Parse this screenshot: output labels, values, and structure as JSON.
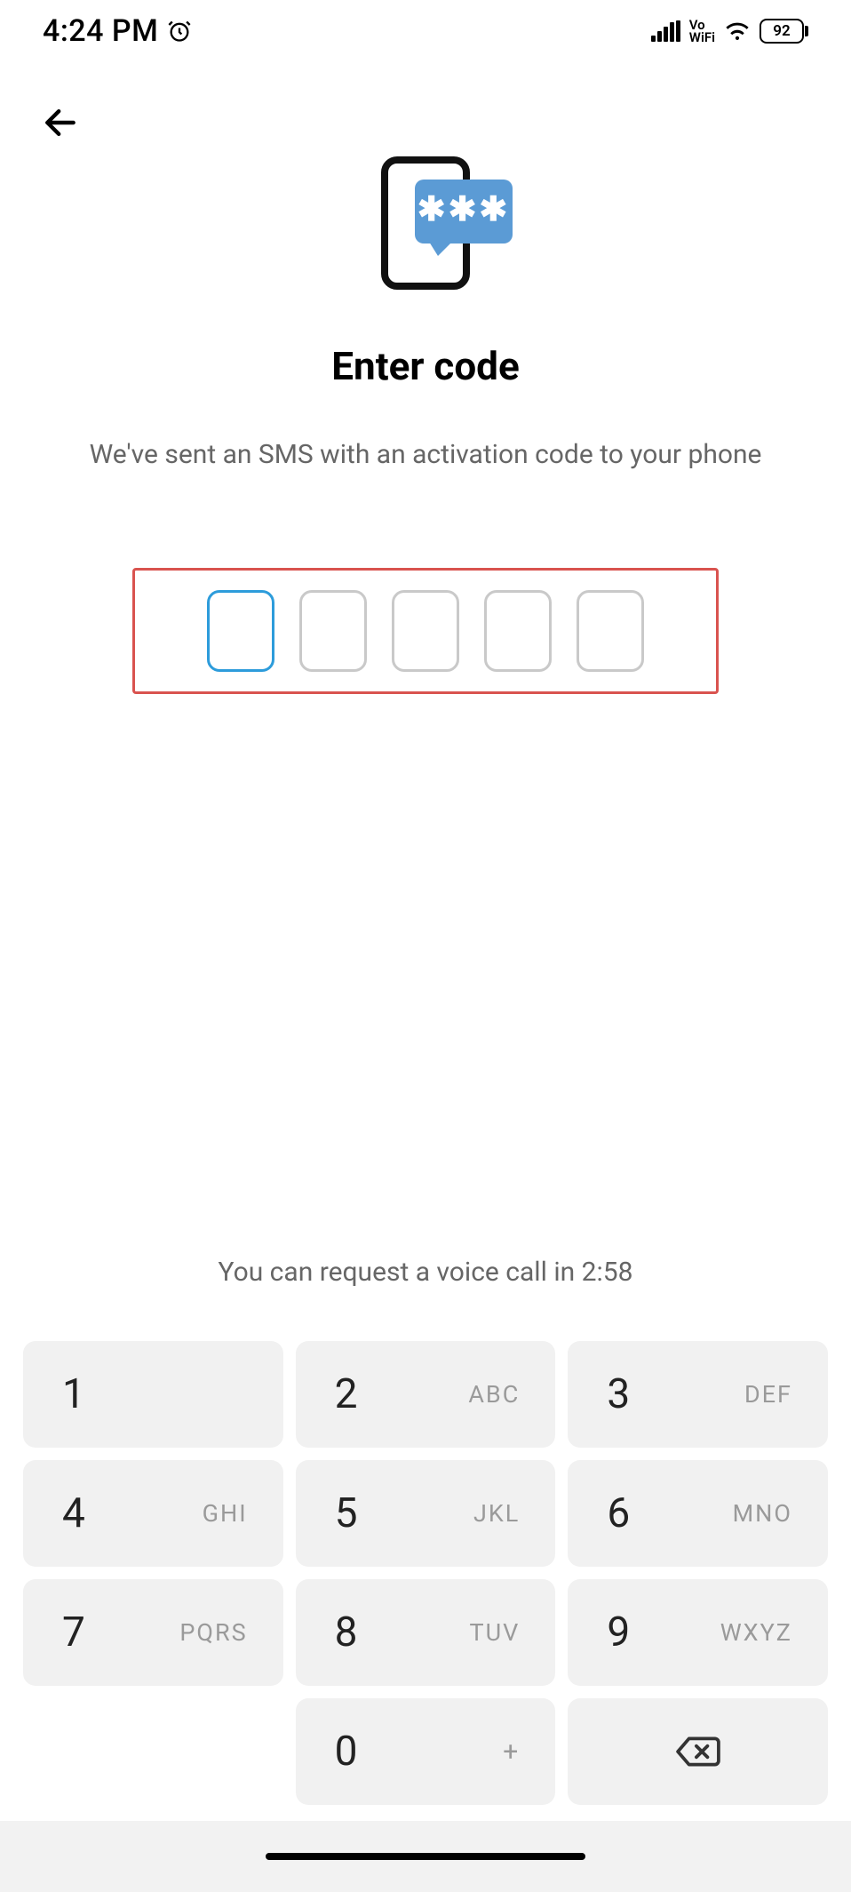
{
  "status": {
    "time": "4:24 PM",
    "battery": "92",
    "vowifi_top": "Vo",
    "vowifi_bottom": "WiFi"
  },
  "screen": {
    "title": "Enter code",
    "subtitle": "We've sent an SMS with an activation code to your phone",
    "icon_stars": "✱✱✱",
    "code_length": 5,
    "request_msg": "You can request a voice call in 2:58"
  },
  "keypad": {
    "k1": {
      "d": "1",
      "l": ""
    },
    "k2": {
      "d": "2",
      "l": "ABC"
    },
    "k3": {
      "d": "3",
      "l": "DEF"
    },
    "k4": {
      "d": "4",
      "l": "GHI"
    },
    "k5": {
      "d": "5",
      "l": "JKL"
    },
    "k6": {
      "d": "6",
      "l": "MNO"
    },
    "k7": {
      "d": "7",
      "l": "PQRS"
    },
    "k8": {
      "d": "8",
      "l": "TUV"
    },
    "k9": {
      "d": "9",
      "l": "WXYZ"
    },
    "k0": {
      "d": "0",
      "l": "+"
    }
  }
}
